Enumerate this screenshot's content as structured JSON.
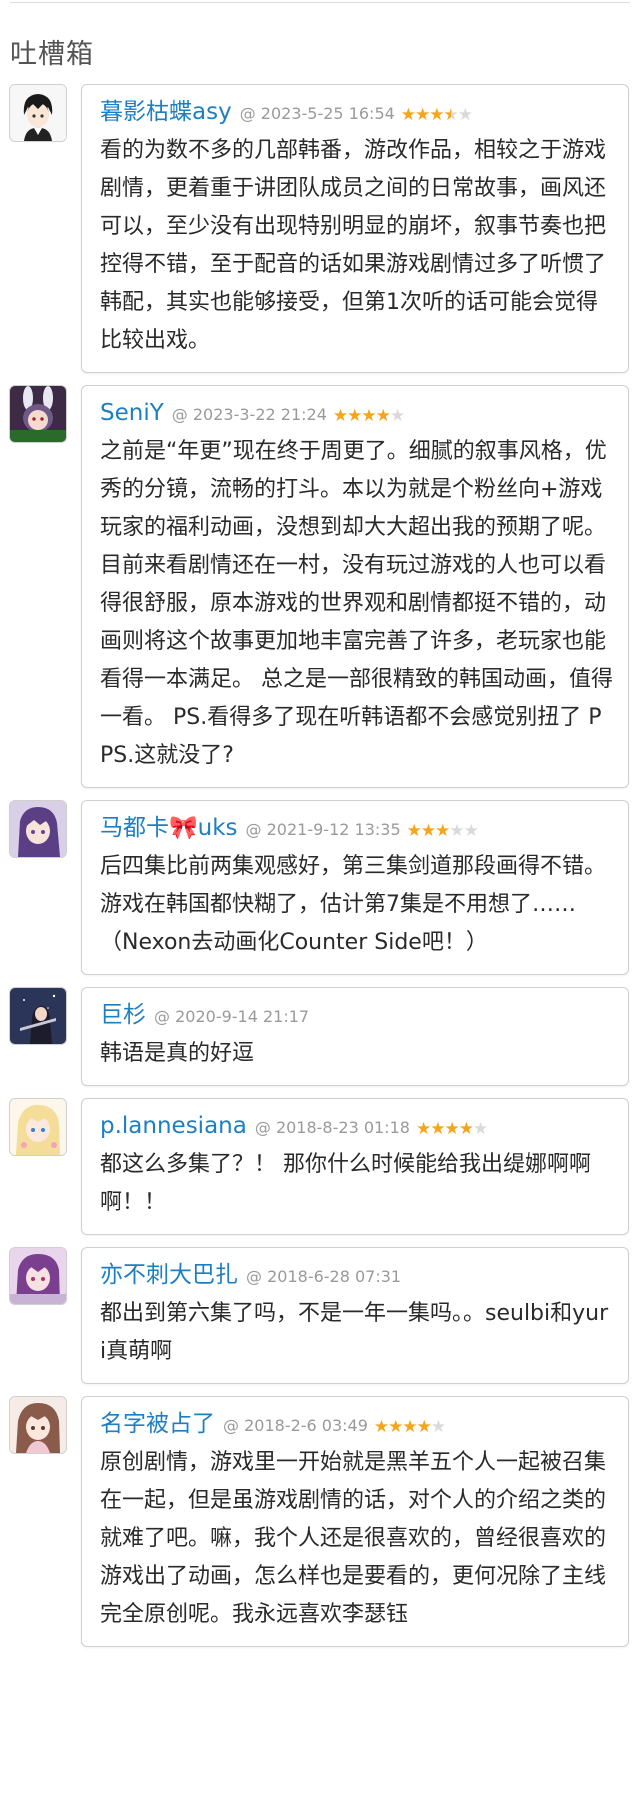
{
  "section": {
    "title": "吐槽箱"
  },
  "colors": {
    "name_link": "#1e7ec2",
    "star_on": "#f4a51c",
    "star_off": "#dadada",
    "date": "#9a9a9a"
  },
  "comments": [
    {
      "name": "暮影枯蝶asy",
      "at": "@",
      "date": "2023-5-25 16:54",
      "rating": 3.5,
      "text": "看的为数不多的几部韩番，游改作品，相较之于游戏剧情，更着重于讲团队成员之间的日常故事，画风还可以，至少没有出现特别明显的崩坏，叙事节奏也把控得不错，至于配音的话如果游戏剧情过多了听惯了韩配，其实也能够接受，但第1次听的话可能会觉得比较出戏。"
    },
    {
      "name": "SeniY",
      "at": "@",
      "date": "2023-3-22 21:24",
      "rating": 4,
      "text": "之前是“年更”现在终于周更了。细腻的叙事风格，优秀的分镜，流畅的打斗。本以为就是个粉丝向+游戏玩家的福利动画，没想到却大大超出我的预期了呢。目前来看剧情还在一村，没有玩过游戏的人也可以看得很舒服，原本游戏的世界观和剧情都挺不错的，动画则将这个故事更加地丰富完善了许多，老玩家也能看得一本满足。 总之是一部很精致的韩国动画，值得一看。 PS.看得多了现在听韩语都不会感觉别扭了 PPS.这就没了?"
    },
    {
      "name": "马都卡🎀uks",
      "at": "@",
      "date": "2021-9-12 13:35",
      "rating": 3,
      "text": "后四集比前两集观感好，第三集剑道那段画得不错。游戏在韩国都快糊了，估计第7集是不用想了……（Nexon去动画化Counter Side吧！）"
    },
    {
      "name": "巨杉",
      "at": "@",
      "date": "2020-9-14 21:17",
      "rating": 0,
      "text": "韩语是真的好逗"
    },
    {
      "name": "p.lannesiana",
      "at": "@",
      "date": "2018-8-23 01:18",
      "rating": 4,
      "text": "都这么多集了？！ 那你什么时候能给我出缇娜啊啊啊！！"
    },
    {
      "name": "亦不刺大巴扎",
      "at": "@",
      "date": "2018-6-28 07:31",
      "rating": 0,
      "text": "都出到第六集了吗，不是一年一集吗。。seulbi和yuri真萌啊"
    },
    {
      "name": "名字被占了",
      "at": "@",
      "date": "2018-2-6 03:49",
      "rating": 4,
      "text": "原创剧情，游戏里一开始就是黑羊五个人一起被召集在一起，但是虽游戏剧情的话，对个人的介绍之类的就难了吧。嘛，我个人还是很喜欢的，曾经很喜欢的游戏出了动画，怎么样也是要看的，更何况除了主线完全原创呢。我永远喜欢李瑟钰"
    }
  ]
}
